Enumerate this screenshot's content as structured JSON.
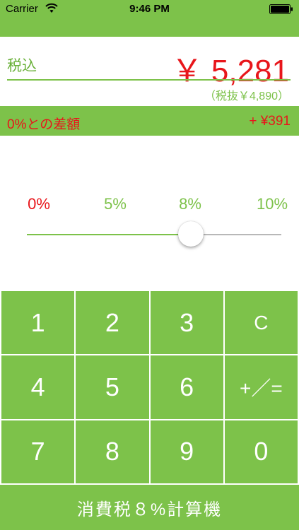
{
  "status_bar": {
    "carrier": "Carrier",
    "time": "9:46 PM"
  },
  "price": {
    "label": "税込",
    "value": "￥ 5,281",
    "pre_tax": "（税抜￥4,890）"
  },
  "diff": {
    "label": "0%との差額",
    "value": "+ ¥391"
  },
  "rates": {
    "options": [
      "0%",
      "5%",
      "8%",
      "10%"
    ],
    "selected_index": 2,
    "highlighted_index": 0
  },
  "slider": {
    "value_percent": 8,
    "min_percent": 0,
    "max_percent": 10
  },
  "keypad": {
    "keys": [
      "1",
      "2",
      "3",
      "C",
      "4",
      "5",
      "6",
      "+／=",
      "7",
      "8",
      "9",
      "0"
    ]
  },
  "app_title": "消費税８%計算機",
  "colors": {
    "accent_green": "#7dc24a",
    "label_green": "#6bb13a",
    "alert_red": "#e8161b",
    "track_gray": "#b8b8b8"
  }
}
